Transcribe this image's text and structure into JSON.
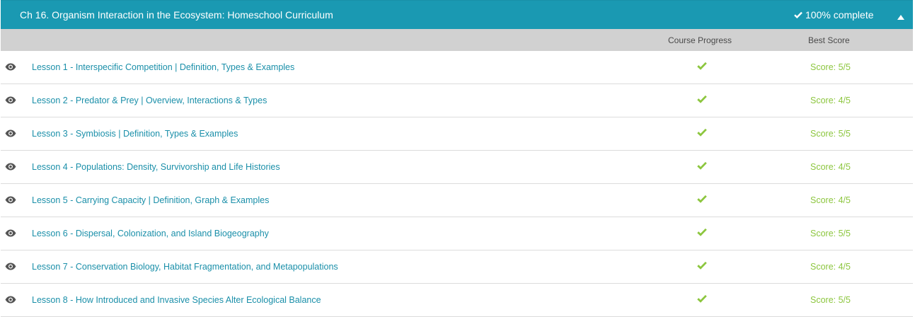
{
  "chapter": {
    "title": "Ch 16. Organism Interaction in the Ecosystem: Homeschool Curriculum",
    "complete_label": "100% complete",
    "icons": {
      "complete": "check-icon",
      "collapse": "caret-up-icon"
    }
  },
  "columns": {
    "progress": "Course Progress",
    "score": "Best Score"
  },
  "colors": {
    "header_bg": "#1a99b2",
    "link": "#1a8fa9",
    "success": "#8cc63e",
    "column_header_bg": "#d1d1d1"
  },
  "lessons": [
    {
      "label": "Lesson 1 - Interspecific Competition | Definition, Types & Examples",
      "score": "Score: 5/5",
      "completed": true
    },
    {
      "label": "Lesson 2 - Predator & Prey | Overview, Interactions & Types",
      "score": "Score: 4/5",
      "completed": true
    },
    {
      "label": "Lesson 3 - Symbiosis | Definition, Types & Examples",
      "score": "Score: 5/5",
      "completed": true
    },
    {
      "label": "Lesson 4 - Populations: Density, Survivorship and Life Histories",
      "score": "Score: 4/5",
      "completed": true
    },
    {
      "label": "Lesson 5 - Carrying Capacity | Definition, Graph & Examples",
      "score": "Score: 4/5",
      "completed": true
    },
    {
      "label": "Lesson 6 - Dispersal, Colonization, and Island Biogeography",
      "score": "Score: 5/5",
      "completed": true
    },
    {
      "label": "Lesson 7 - Conservation Biology, Habitat Fragmentation, and Metapopulations",
      "score": "Score: 4/5",
      "completed": true
    },
    {
      "label": "Lesson 8 - How Introduced and Invasive Species Alter Ecological Balance",
      "score": "Score: 5/5",
      "completed": true
    }
  ]
}
